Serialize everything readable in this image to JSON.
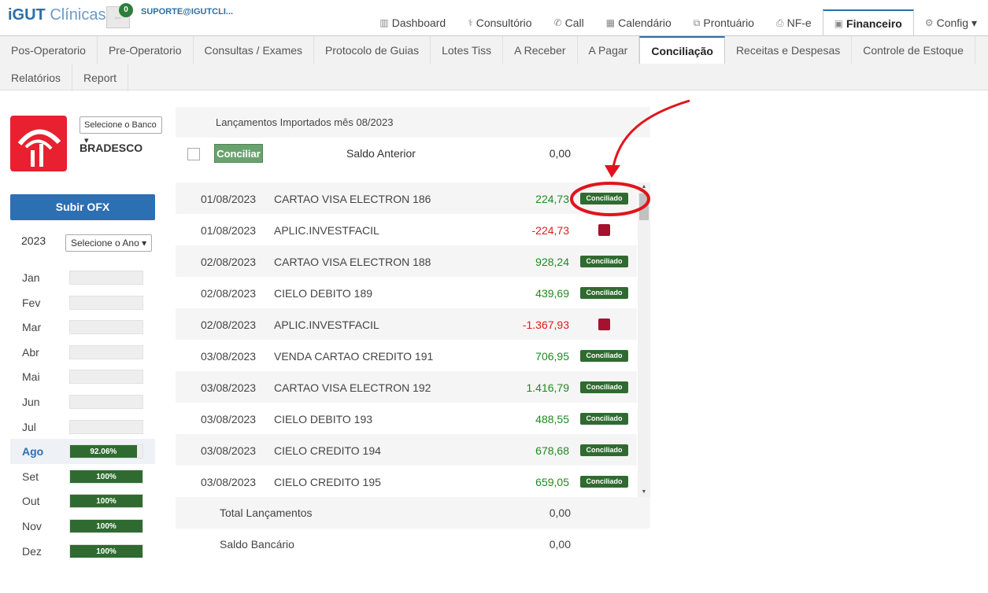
{
  "brand": {
    "name_bold": "iGUT",
    "name_rest": " Clínicas",
    "notif_count": "0",
    "user": "SUPORTE@IGUTCLI..."
  },
  "topnav": [
    {
      "icon": "▥",
      "label": "Dashboard"
    },
    {
      "icon": "⚕",
      "label": "Consultório"
    },
    {
      "icon": "✆",
      "label": "Call"
    },
    {
      "icon": "▦",
      "label": "Calendário"
    },
    {
      "icon": "⧉",
      "label": "Prontuário"
    },
    {
      "icon": "⎙",
      "label": "NF-e"
    },
    {
      "icon": "▣",
      "label": "Financeiro"
    },
    {
      "icon": "⚙",
      "label": "Config ▾"
    }
  ],
  "subnav": [
    "Pos-Operatorio",
    "Pre-Operatorio",
    "Consultas / Exames",
    "Protocolo de Guias",
    "Lotes Tiss",
    "A Receber",
    "A Pagar",
    "Conciliação",
    "Receitas e Despesas",
    "Controle de Estoque",
    "Relatórios",
    "Report"
  ],
  "bank": {
    "select_label": "Selecione o Banco ▾",
    "name": "BRADESCO"
  },
  "upload_label": "Subir OFX",
  "year": {
    "value": "2023",
    "select_label": "Selecione o Ano ▾"
  },
  "months": [
    {
      "label": "Jan",
      "pct": ""
    },
    {
      "label": "Fev",
      "pct": ""
    },
    {
      "label": "Mar",
      "pct": ""
    },
    {
      "label": "Abr",
      "pct": ""
    },
    {
      "label": "Mai",
      "pct": ""
    },
    {
      "label": "Jun",
      "pct": ""
    },
    {
      "label": "Jul",
      "pct": ""
    },
    {
      "label": "Ago",
      "pct": "92.06%"
    },
    {
      "label": "Set",
      "pct": "100%"
    },
    {
      "label": "Out",
      "pct": "100%"
    },
    {
      "label": "Nov",
      "pct": "100%"
    },
    {
      "label": "Dez",
      "pct": "100%"
    }
  ],
  "table": {
    "title": "Lançamentos Importados mês 08/2023",
    "reconcile_label": "Conciliar",
    "prev_balance_label": "Saldo Anterior",
    "prev_balance": "0,00",
    "badge_label": "Conciliado",
    "rows": [
      {
        "date": "01/08/2023",
        "desc": "CARTAO VISA ELECTRON 186",
        "amount": "224,73",
        "sign": "pos",
        "status": "Conciliado"
      },
      {
        "date": "01/08/2023",
        "desc": "APLIC.INVESTFACIL",
        "amount": "-224,73",
        "sign": "neg",
        "status": "pending"
      },
      {
        "date": "02/08/2023",
        "desc": "CARTAO VISA ELECTRON 188",
        "amount": "928,24",
        "sign": "pos",
        "status": "Conciliado"
      },
      {
        "date": "02/08/2023",
        "desc": "CIELO DEBITO 189",
        "amount": "439,69",
        "sign": "pos",
        "status": "Conciliado"
      },
      {
        "date": "02/08/2023",
        "desc": "APLIC.INVESTFACIL",
        "amount": "-1.367,93",
        "sign": "neg",
        "status": "pending"
      },
      {
        "date": "03/08/2023",
        "desc": "VENDA CARTAO CREDITO 191",
        "amount": "706,95",
        "sign": "pos",
        "status": "Conciliado"
      },
      {
        "date": "03/08/2023",
        "desc": "CARTAO VISA ELECTRON 192",
        "amount": "1.416,79",
        "sign": "pos",
        "status": "Conciliado"
      },
      {
        "date": "03/08/2023",
        "desc": "CIELO DEBITO 193",
        "amount": "488,55",
        "sign": "pos",
        "status": "Conciliado"
      },
      {
        "date": "03/08/2023",
        "desc": "CIELO CREDITO 194",
        "amount": "678,68",
        "sign": "pos",
        "status": "Conciliado"
      },
      {
        "date": "03/08/2023",
        "desc": "CIELO CREDITO 195",
        "amount": "659,05",
        "sign": "pos",
        "status": "Conciliado"
      }
    ],
    "total_label": "Total Lançamentos",
    "total": "0,00",
    "bank_balance_label": "Saldo Bancário",
    "bank_balance": "0,00"
  },
  "colors": {
    "accent": "#2d6fb3",
    "reconciled": "#2f6b30",
    "pending": "#a5112e",
    "annotation": "#e0141c"
  }
}
